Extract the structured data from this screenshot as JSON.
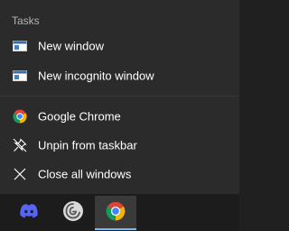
{
  "jumplist": {
    "tasks_header": "Tasks",
    "tasks": [
      {
        "label": "New window",
        "icon": "window-icon"
      },
      {
        "label": "New incognito window",
        "icon": "window-icon"
      }
    ],
    "app_actions": [
      {
        "label": "Google Chrome",
        "icon": "chrome-icon"
      },
      {
        "label": "Unpin from taskbar",
        "icon": "unpin-icon"
      },
      {
        "label": "Close all windows",
        "icon": "close-icon"
      }
    ]
  },
  "taskbar": {
    "apps": [
      {
        "name": "discord",
        "icon": "discord-icon",
        "active": false
      },
      {
        "name": "app",
        "icon": "app-icon",
        "active": false
      },
      {
        "name": "chrome",
        "icon": "chrome-icon",
        "active": true
      }
    ]
  },
  "colors": {
    "menu_bg": "#2b2b2b",
    "taskbar_bg": "#1c1c1c",
    "accent": "#76b9ed",
    "discord": "#5865f2"
  }
}
